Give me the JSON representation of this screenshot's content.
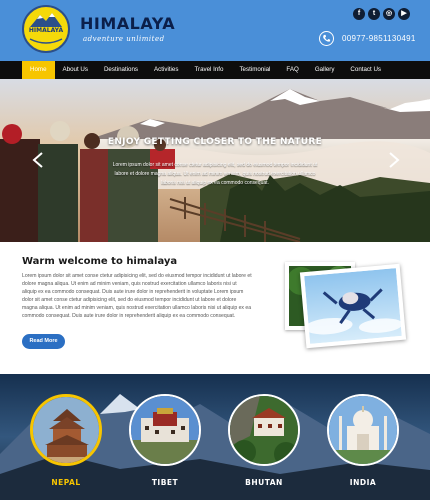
{
  "header": {
    "logo_text": "HIMALAYA",
    "brand": "HIMALAYA",
    "tagline": "adventure unlimited",
    "social_icons": [
      "facebook-icon",
      "twitter-icon",
      "instagram-icon",
      "youtube-icon"
    ],
    "phone": "00977-9851130491",
    "colors": {
      "header_bg": "#4a8fd8",
      "accent": "#f7c500",
      "nav_bg": "#0d0d0d",
      "button": "#2b6fc3"
    }
  },
  "nav": {
    "items": [
      "Home",
      "About Us",
      "Destinations",
      "Activities",
      "Travel Info",
      "Testimonial",
      "FAQ",
      "Gallery",
      "Contact Us"
    ],
    "active": "Home"
  },
  "hero": {
    "title": "ENJOY GETTING CLOSER TO THE NATURE",
    "text": "Lorem ipsum dolor sit amet conse ctetur adipisicing elit, sed do eiusmod tempor incididunt ut labore et dolore magna aliqua. Ut enim ad minim veniam, quis nostrud exercitation ullamco laboris nisi ut aliquip ex ea commodo consequat."
  },
  "welcome": {
    "title": "Warm welcome to himalaya",
    "body": "Lorem ipsum dolor sit amet conse ctetur adipisicing elit, sed do eiusmod tempor incididunt ut labore et dolore magna aliqua. Ut enim ad minim veniam, quis nostrud exercitation ullamco laboris nisi ut aliquip ex ea commodo consequat. Duis aute irure dolor in reprehenderit in voluptate Lorem ipsum dolor sit amet conse ctetur adipisicing elit, sed do eiusmod tempor incididunt ut labore et dolore magna aliqua. Ut enim ad minim veniam, quis nostrud exercitation ullamco laboris nisi ut aliquip ex ea commodo consequat. Duis aute irure dolor in reprehenderit aliquip ex ea commodo consequat.",
    "read_more": "Read More"
  },
  "destinations": [
    {
      "name": "NEPAL",
      "active": true
    },
    {
      "name": "TIBET",
      "active": false
    },
    {
      "name": "BHUTAN",
      "active": false
    },
    {
      "name": "INDIA",
      "active": false
    }
  ]
}
